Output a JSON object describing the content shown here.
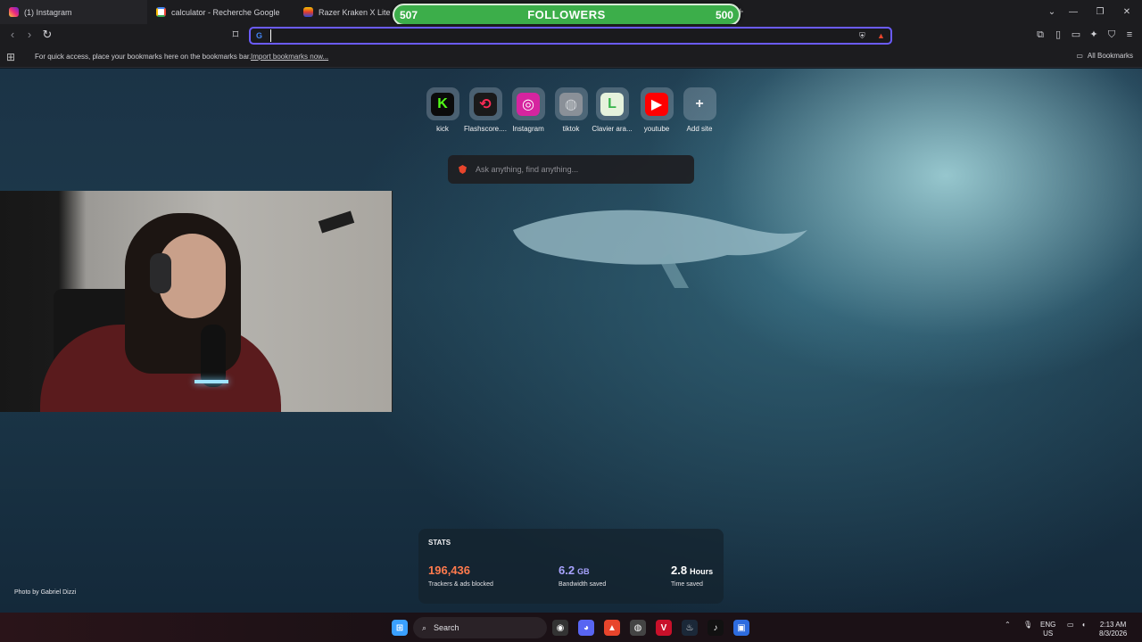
{
  "tabs": [
    {
      "title": "(1) Instagram",
      "icon": "instagram-icon"
    },
    {
      "title": "calculator - Recherche Google",
      "icon": "google-icon"
    },
    {
      "title": "Razer Kraken X Lite (Noir",
      "icon": "razer-icon"
    }
  ],
  "followers_overlay": {
    "left": "507",
    "label": "FOLLOWERS",
    "right": "500"
  },
  "omnibox": {
    "value": "",
    "placeholder": ""
  },
  "bookmarks_bar": {
    "message": "For quick access, place your bookmarks here on the bookmarks bar.",
    "import_link": "Import bookmarks now...",
    "all_bookmarks": "All Bookmarks"
  },
  "shortcuts": [
    {
      "label": "kick",
      "glyph": "K",
      "bg": "#0b0b0b",
      "fg": "#53fc18"
    },
    {
      "label": "Flashscore....",
      "glyph": "⟲",
      "bg": "#1a1a1a",
      "fg": "#ff2a55"
    },
    {
      "label": "Instagram",
      "glyph": "◎",
      "bg": "#d6249f",
      "fg": "#ffffff"
    },
    {
      "label": "tiktok",
      "glyph": "◍",
      "bg": "#8a9098",
      "fg": "#c8ccd0"
    },
    {
      "label": "Clavier ara...",
      "glyph": "L",
      "bg": "#e6f2dc",
      "fg": "#36b34a"
    },
    {
      "label": "youtube",
      "glyph": "▶",
      "bg": "#ff0000",
      "fg": "#ffffff"
    },
    {
      "label": "Add site",
      "glyph": "+",
      "bg": "transparent",
      "fg": "#f0f0f2"
    }
  ],
  "search_box": {
    "placeholder": "Ask anything, find anything..."
  },
  "stats": {
    "title": "STATS",
    "trackers": {
      "value": "196,436",
      "unit": "",
      "desc": "Trackers & ads blocked",
      "color": "#ff7a4d"
    },
    "bandwidth": {
      "value": "6.2",
      "unit": "GB",
      "desc": "Bandwidth saved",
      "color": "#a8a3ff"
    },
    "time": {
      "value": "2.8",
      "unit": "Hours",
      "desc": "Time saved",
      "color": "#ffffff"
    }
  },
  "photo_credit": "Photo by Gabriel Dizzi",
  "taskbar": {
    "search_label": "Search",
    "lang_top": "ENG",
    "lang_bottom": "US",
    "time": "2:13 AM",
    "date": "8/3/2026"
  }
}
